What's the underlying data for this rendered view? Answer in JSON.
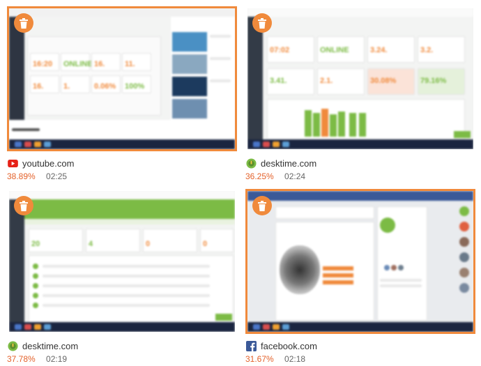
{
  "cards": [
    {
      "site": "youtube.com",
      "percent": "38.89%",
      "duration": "02:25",
      "icon": "youtube-icon",
      "selected": true
    },
    {
      "site": "desktime.com",
      "percent": "36.25%",
      "duration": "02:24",
      "icon": "desktime-icon",
      "selected": false
    },
    {
      "site": "desktime.com",
      "percent": "37.78%",
      "duration": "02:19",
      "icon": "desktime-icon",
      "selected": false
    },
    {
      "site": "facebook.com",
      "percent": "31.67%",
      "duration": "02:18",
      "icon": "facebook-icon",
      "selected": true
    }
  ],
  "colors": {
    "accent": "#f08a3c",
    "percent_text": "#e4622b",
    "youtube": "#e62117",
    "facebook": "#3b5998",
    "desktime": "#7cbb45"
  }
}
